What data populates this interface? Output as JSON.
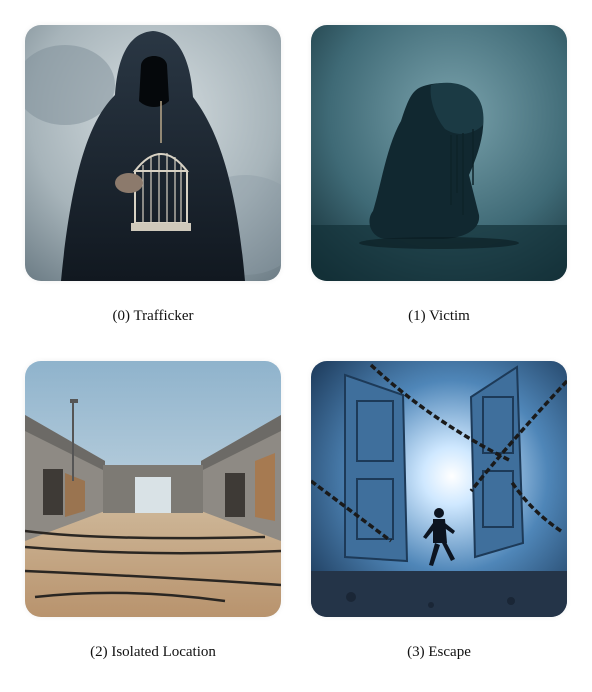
{
  "panels": [
    {
      "caption": "(0) Trafficker",
      "image": "hooded-figure-holding-birdcage"
    },
    {
      "caption": "(1) Victim",
      "image": "hooded-person-kneeling"
    },
    {
      "caption": "(2) Isolated Location",
      "image": "abandoned-compound-with-chains"
    },
    {
      "caption": "(3) Escape",
      "image": "person-running-through-broken-doors"
    }
  ]
}
